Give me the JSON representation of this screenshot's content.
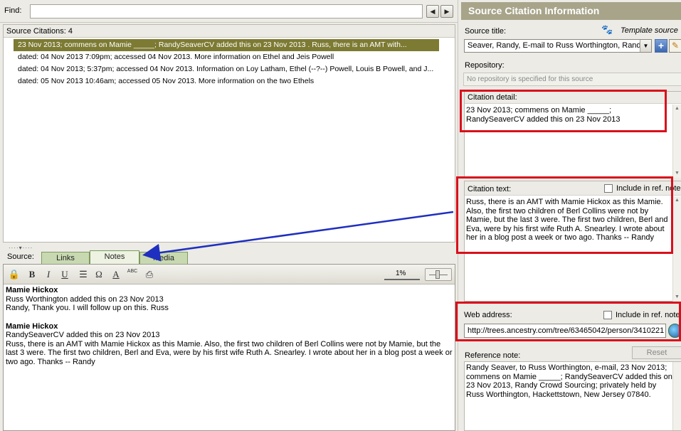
{
  "find": {
    "label": "Find:",
    "value": ""
  },
  "citations": {
    "count_label": "Source Citations: 4",
    "rows": [
      "23 Nov 2013; commens on Mamie _____; RandySeaverCV added this on 23 Nov 2013 . Russ, there is an AMT with...",
      "dated: 04 Nov 2013 7:09pm; accessed 04 Nov 2013. More information on Ethel and Jeis Powell",
      "dated: 04 Nov 2013; 5:37pm; accessed 04 Nov 2013. Information on Loy Latham, Ethel (--?--) Powell, Louis B Powell, and J...",
      "dated: 05 Nov 2013 10:46am; accessed 05 Nov 2013. More information on the two Ethels"
    ]
  },
  "tabs": {
    "source_label": "Source:",
    "links": "Links",
    "notes": "Notes",
    "media": "Media"
  },
  "editor": {
    "zoom": "1%",
    "toolbar": {
      "bold": "B",
      "italic": "I",
      "underline": "U",
      "omega": "Ω",
      "color": "A",
      "spell": "ABC"
    },
    "notes": [
      {
        "name": "Mamie Hickox",
        "line1": "Russ Worthington added this on 23 Nov 2013",
        "line2": "Randy, Thank you. I will follow up on this. Russ"
      },
      {
        "name": "Mamie Hickox",
        "line1": "RandySeaverCV added this on 23 Nov 2013",
        "line2": "Russ, there is an AMT with Mamie Hickox as this Mamie. Also, the first two children of Berl Collins were not by Mamie, but the last 3 were. The first two children, Berl and Eva, were by his first wife Ruth A. Snearley. I wrote about her in a blog post a week or two ago. Thanks -- Randy"
      }
    ]
  },
  "right": {
    "header": "Source Citation Information",
    "source_title_label": "Source title:",
    "template_source": "Template source",
    "source_title_value": "Seaver, Randy, E-mail to Russ Worthington, Randy",
    "repository_label": "Repository:",
    "repository_value": "No repository is specified for this source",
    "citation_detail_label": "Citation detail:",
    "citation_detail_text": "23 Nov 2013; commens on Mamie _____; RandySeaverCV added this on 23 Nov 2013",
    "citation_text_label": "Citation text:",
    "include_in_ref_note": "Include in ref. note",
    "citation_text": "Russ, there is an AMT with Mamie Hickox as this Mamie. Also, the first two children of Berl Collins were not by Mamie, but the last 3 were. The first two children, Berl and Eva, were by his first wife Ruth A. Snearley. I wrote about her in a blog post a week or two ago. Thanks -- Randy",
    "web_address_label": "Web address:",
    "web_address_value": "http://trees.ancestry.com/tree/63465042/person/3410221",
    "reference_note_label": "Reference note:",
    "reset_label": "Reset",
    "reference_note_text": "Randy Seaver, to Russ Worthington, e-mail, 23 Nov 2013; commens on Mamie _____; RandySeaverCV added this on 23 Nov 2013, Randy Crowd Sourcing; privately held by Russ Worthington, Hackettstown, New Jersey 07840."
  },
  "colors": {
    "selection": "#7d7a33",
    "header": "#a7a48a",
    "annotation": "#d9101c",
    "arrow": "#1f2fbf"
  }
}
